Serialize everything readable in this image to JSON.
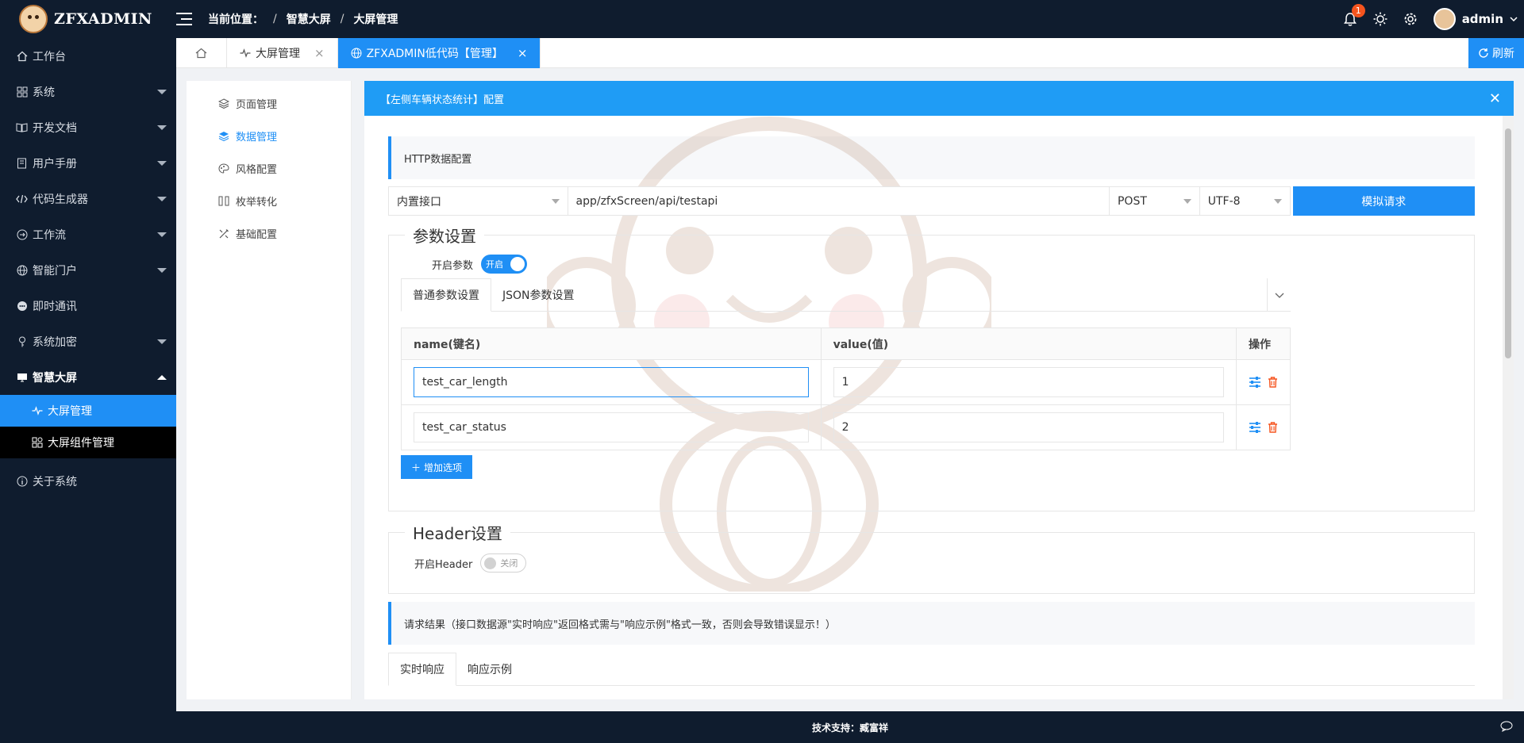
{
  "brand": {
    "name": "ZFXADMIN"
  },
  "breadcrumb": {
    "label": "当前位置：",
    "items": [
      "智慧大屏",
      "大屏管理"
    ]
  },
  "header": {
    "notification_count": "1",
    "username": "admin"
  },
  "sidebar": {
    "items": [
      {
        "label": "工作台",
        "icon": "home-icon"
      },
      {
        "label": "系统",
        "icon": "apps-icon"
      },
      {
        "label": "开发文档",
        "icon": "book-icon"
      },
      {
        "label": "用户手册",
        "icon": "manual-icon"
      },
      {
        "label": "代码生成器",
        "icon": "code-icon"
      },
      {
        "label": "工作流",
        "icon": "workflow-icon"
      },
      {
        "label": "智能门户",
        "icon": "globe-icon"
      },
      {
        "label": "即时通讯",
        "icon": "chat-icon"
      },
      {
        "label": "系统加密",
        "icon": "key-icon"
      },
      {
        "label": "智慧大屏",
        "icon": "screen-icon"
      }
    ],
    "sub_items": [
      {
        "label": "大屏管理",
        "icon": "pulse-icon"
      },
      {
        "label": "大屏组件管理",
        "icon": "widgets-icon"
      }
    ],
    "about": "关于系统"
  },
  "tabs": {
    "items": [
      {
        "label": "大屏管理"
      },
      {
        "label": "ZFXADMIN低代码【管理】"
      }
    ],
    "refresh": "刷新"
  },
  "inner_nav": [
    "页面管理",
    "数据管理",
    "风格配置",
    "枚举转化",
    "基础配置"
  ],
  "modal": {
    "title": "【左侧车辆状态统计】配置",
    "http_section": "HTTP数据配置",
    "source": "内置接口",
    "url": "app/zfxScreen/api/testapi",
    "method": "POST",
    "encoding": "UTF-8",
    "mock_button": "模拟请求",
    "params_legend": "参数设置",
    "params_switch_label": "开启参数",
    "params_switch_state": "开启",
    "subtabs": [
      "普通参数设置",
      "JSON参数设置"
    ],
    "table": {
      "headers": [
        "name(键名)",
        "value(值)",
        "操作"
      ],
      "rows": [
        {
          "name": "test_car_length",
          "value": "1"
        },
        {
          "name": "test_car_status",
          "value": "2"
        }
      ]
    },
    "add_button": "增加选项",
    "header_legend": "Header设置",
    "header_switch_label": "开启Header",
    "header_switch_state": "关闭",
    "result_section": "请求结果（接口数据源\"实时响应\"返回格式需与\"响应示例\"格式一致，否则会导致错误显示！）",
    "result_tabs": [
      "实时响应",
      "响应示例"
    ]
  },
  "footer": {
    "text": "技术支持：臧富祥"
  },
  "colors": {
    "primary": "#1f8ff5",
    "dark": "#0f1c2e",
    "danger": "#f5541e"
  }
}
